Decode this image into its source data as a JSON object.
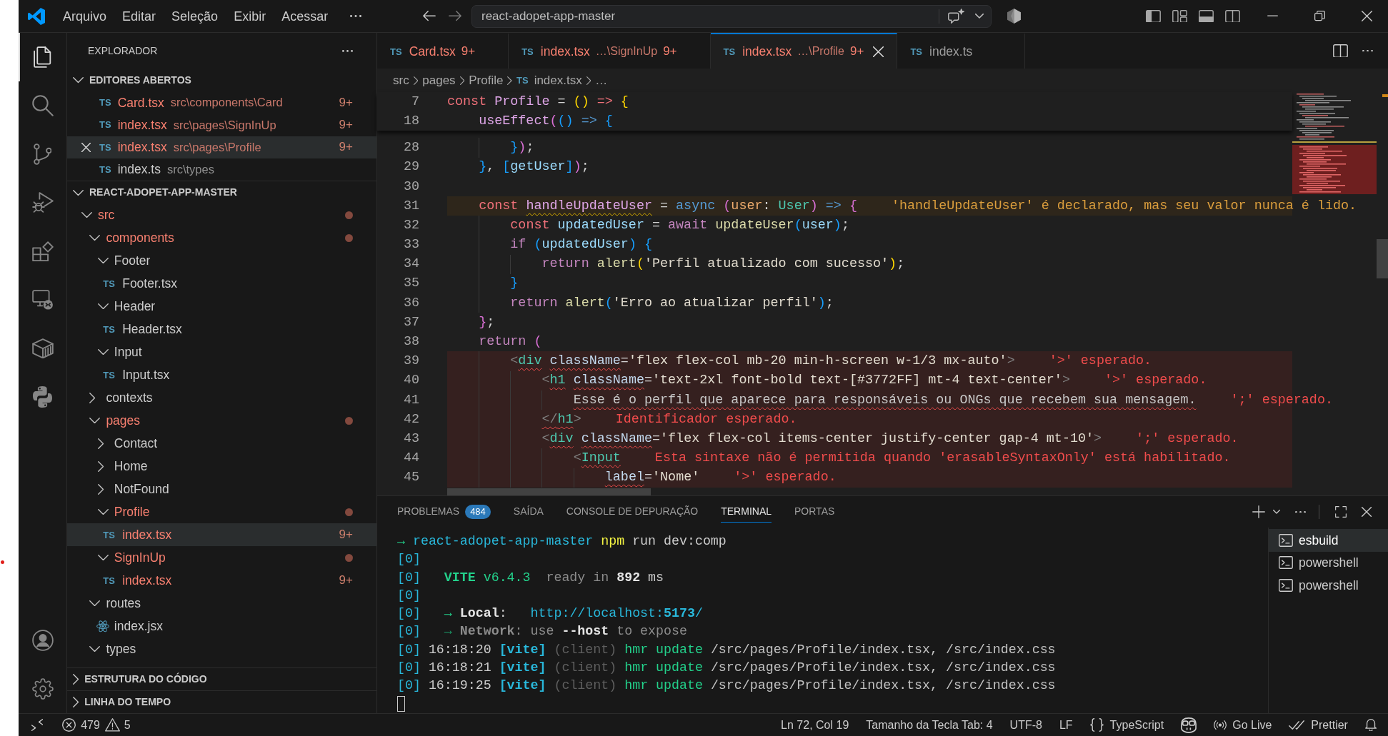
{
  "title_bar": {
    "menu": [
      {
        "label": "Arquivo"
      },
      {
        "label": "Editar"
      },
      {
        "label": "Seleção"
      },
      {
        "label": "Exibir"
      },
      {
        "label": "Acessar"
      }
    ],
    "command_center": {
      "label": "react-adopet-app-master"
    }
  },
  "activity_bar": {
    "items": [
      {
        "kind": "explorer",
        "selected": true
      },
      {
        "kind": "search",
        "selected": false
      },
      {
        "kind": "source-control",
        "selected": false
      },
      {
        "kind": "run-debug",
        "selected": false
      },
      {
        "kind": "extensions",
        "selected": false
      },
      {
        "kind": "remote",
        "selected": false
      },
      {
        "kind": "containers",
        "selected": false
      },
      {
        "kind": "python",
        "selected": false
      }
    ],
    "bottom_items": [
      {
        "kind": "account"
      },
      {
        "kind": "settings"
      }
    ]
  },
  "sidebar": {
    "title": "EXPLORADOR",
    "open_editors": {
      "title": "EDITORES ABERTOS",
      "expanded": true,
      "items": [
        {
          "type_label": "TS",
          "name": "Card.tsx",
          "path": "src\\components\\Card",
          "problems": true,
          "badge": "9+",
          "selected": false
        },
        {
          "type_label": "TS",
          "name": "index.tsx",
          "path": "src\\pages\\SignInUp",
          "problems": true,
          "badge": "9+",
          "selected": false
        },
        {
          "type_label": "TS",
          "name": "index.tsx",
          "path": "src\\pages\\Profile",
          "problems": true,
          "badge": "9+",
          "selected": true
        },
        {
          "type_label": "TS",
          "name": "index.ts",
          "path": "src\\types",
          "problems": false,
          "selected": false
        }
      ]
    },
    "project": {
      "title": "REACT-ADOPET-APP-MASTER",
      "expanded": true,
      "tree": [
        {
          "kind": "folder",
          "label": "src",
          "expanded": true,
          "problems": true,
          "selected": false,
          "children": [
            {
              "kind": "folder",
              "label": "components",
              "expanded": true,
              "problems": true,
              "selected": false,
              "children": [
                {
                  "kind": "folder",
                  "label": "Footer",
                  "expanded": true,
                  "problems": false,
                  "selected": false,
                  "children": [
                    {
                      "kind": "ts",
                      "type_label": "TS",
                      "label": "Footer.tsx",
                      "problems": false,
                      "selected": false
                    }
                  ]
                },
                {
                  "kind": "folder",
                  "label": "Header",
                  "expanded": true,
                  "problems": false,
                  "selected": false,
                  "children": [
                    {
                      "kind": "ts",
                      "type_label": "TS",
                      "label": "Header.tsx",
                      "problems": false,
                      "selected": false
                    }
                  ]
                },
                {
                  "kind": "folder",
                  "label": "Input",
                  "expanded": true,
                  "problems": false,
                  "selected": false,
                  "children": [
                    {
                      "kind": "ts",
                      "type_label": "TS",
                      "label": "Input.tsx",
                      "problems": false,
                      "selected": false
                    }
                  ]
                }
              ]
            },
            {
              "kind": "folder",
              "label": "contexts",
              "expanded": false,
              "problems": false,
              "selected": false
            },
            {
              "kind": "folder",
              "label": "pages",
              "expanded": true,
              "problems": true,
              "selected": false,
              "children": [
                {
                  "kind": "folder",
                  "label": "Contact",
                  "expanded": false,
                  "problems": false,
                  "selected": false
                },
                {
                  "kind": "folder",
                  "label": "Home",
                  "expanded": false,
                  "problems": false,
                  "selected": false
                },
                {
                  "kind": "folder",
                  "label": "NotFound",
                  "expanded": false,
                  "problems": false,
                  "selected": false
                },
                {
                  "kind": "folder",
                  "label": "Profile",
                  "expanded": true,
                  "problems": true,
                  "selected": false,
                  "children": [
                    {
                      "kind": "ts",
                      "type_label": "TS",
                      "label": "index.tsx",
                      "problems": true,
                      "badge": "9+",
                      "selected": true
                    }
                  ]
                },
                {
                  "kind": "folder",
                  "label": "SignInUp",
                  "expanded": true,
                  "problems": true,
                  "selected": false,
                  "children": [
                    {
                      "kind": "ts",
                      "type_label": "TS",
                      "label": "index.tsx",
                      "problems": true,
                      "badge": "9+",
                      "selected": false
                    }
                  ]
                }
              ]
            },
            {
              "kind": "folder",
              "label": "routes",
              "expanded": true,
              "problems": false,
              "selected": false,
              "children": [
                {
                  "kind": "react",
                  "label": "index.jsx",
                  "problems": false,
                  "selected": false
                }
              ]
            },
            {
              "kind": "folder",
              "label": "types",
              "expanded": true,
              "problems": false,
              "selected": false
            }
          ]
        }
      ]
    },
    "collapsed_sections": [
      {
        "title": "ESTRUTURA DO CÓDIGO",
        "expanded": false
      },
      {
        "title": "LINHA DO TEMPO",
        "expanded": false
      }
    ]
  },
  "editor": {
    "tabs": [
      {
        "type_label": "TS",
        "name": "Card.tsx",
        "badge": "9+",
        "problems": true,
        "selected": false
      },
      {
        "type_label": "TS",
        "name": "index.tsx",
        "description": "…\\SignInUp",
        "badge": "9+",
        "problems": true,
        "selected": false
      },
      {
        "type_label": "TS",
        "name": "index.tsx",
        "description": "…\\Profile",
        "badge": "9+",
        "problems": true,
        "selected": true
      },
      {
        "type_label": "TS",
        "name": "index.ts",
        "problems": false,
        "selected": false
      }
    ],
    "breadcrumb": [
      {
        "kind": "folder",
        "label": "src"
      },
      {
        "kind": "folder",
        "label": "pages"
      },
      {
        "kind": "folder",
        "label": "Profile"
      },
      {
        "kind": "file",
        "type_label": "TS",
        "label": "index.tsx"
      },
      {
        "kind": "symbol",
        "label": "…"
      }
    ],
    "sticky_lines": [
      {
        "number": "7",
        "tokens": [
          {
            "text": "const",
            "kind": "storage"
          },
          {
            "text": " Profile",
            "kind": "function-name"
          },
          {
            "text": " =",
            "kind": "plain"
          },
          {
            "text": " ()",
            "kind": "bracket1"
          },
          {
            "text": " =>",
            "kind": "storage"
          },
          {
            "text": " {",
            "kind": "bracket1"
          }
        ]
      },
      {
        "number": "18",
        "tokens": [
          {
            "text": "    useEffect",
            "kind": "function-name"
          },
          {
            "text": "(",
            "kind": "bracket2"
          },
          {
            "text": "()",
            "kind": "bracket3"
          },
          {
            "text": " =>",
            "kind": "modifier"
          },
          {
            "text": " {",
            "kind": "bracket3"
          }
        ]
      }
    ],
    "lines": [
      {
        "number": "28",
        "tokens": [
          {
            "text": "        }",
            "kind": "bracket3"
          },
          {
            "text": ")",
            "kind": "bracket2"
          },
          {
            "text": ";",
            "kind": "plain"
          }
        ]
      },
      {
        "number": "29",
        "tokens": [
          {
            "text": "    }",
            "kind": "bracket3"
          },
          {
            "text": ", ",
            "kind": "plain"
          },
          {
            "text": "[",
            "kind": "bracket3"
          },
          {
            "text": "getUser",
            "kind": "variable"
          },
          {
            "text": "]",
            "kind": "bracket3"
          },
          {
            "text": ")",
            "kind": "bracket2"
          },
          {
            "text": ";",
            "kind": "plain"
          }
        ]
      },
      {
        "number": "30"
      },
      {
        "number": "31",
        "tokens": [
          {
            "text": "    const ",
            "kind": "storage",
            "squiggly": false
          },
          {
            "text": "handleUpdateUser",
            "kind": "function-name",
            "squiggly": true
          },
          {
            "text": " =",
            "kind": "plain",
            "squiggly": false
          },
          {
            "text": " async",
            "kind": "modifier",
            "squiggly": false
          },
          {
            "text": " (",
            "kind": "bracket2",
            "squiggly": false
          },
          {
            "text": "user",
            "kind": "parameter",
            "squiggly": false
          },
          {
            "text": ":",
            "kind": "plain",
            "squiggly": false
          },
          {
            "text": " User",
            "kind": "type",
            "squiggly": false
          },
          {
            "text": ")",
            "kind": "bracket2",
            "squiggly": false
          },
          {
            "text": " =>",
            "kind": "modifier",
            "squiggly": false
          },
          {
            "text": " {",
            "kind": "bracket2",
            "squiggly": false
          }
        ],
        "diagnostic": {
          "kind": "warning",
          "message": "'handleUpdateUser' é declarado, mas seu valor nunca é lido."
        }
      },
      {
        "number": "32",
        "tokens": [
          {
            "text": "        const",
            "kind": "storage"
          },
          {
            "text": " updatedUser",
            "kind": "variable"
          },
          {
            "text": " =",
            "kind": "plain"
          },
          {
            "text": " await",
            "kind": "keyword"
          },
          {
            "text": " updateUser",
            "kind": "call"
          },
          {
            "text": "(",
            "kind": "bracket3"
          },
          {
            "text": "user",
            "kind": "variable"
          },
          {
            "text": ")",
            "kind": "bracket3"
          },
          {
            "text": ";",
            "kind": "plain"
          }
        ]
      },
      {
        "number": "33",
        "tokens": [
          {
            "text": "        if",
            "kind": "keyword"
          },
          {
            "text": " (",
            "kind": "bracket3"
          },
          {
            "text": "updatedUser",
            "kind": "variable"
          },
          {
            "text": ")",
            "kind": "bracket3"
          },
          {
            "text": " {",
            "kind": "bracket3"
          }
        ]
      },
      {
        "number": "34",
        "tokens": [
          {
            "text": "            return",
            "kind": "keyword"
          },
          {
            "text": " alert",
            "kind": "call"
          },
          {
            "text": "(",
            "kind": "bracket1"
          },
          {
            "text": "'Perfil atualizado com sucesso'",
            "kind": "string"
          },
          {
            "text": ")",
            "kind": "bracket1"
          },
          {
            "text": ";",
            "kind": "plain"
          }
        ]
      },
      {
        "number": "35",
        "tokens": [
          {
            "text": "        }",
            "kind": "bracket3"
          }
        ]
      },
      {
        "number": "36",
        "tokens": [
          {
            "text": "        return",
            "kind": "keyword"
          },
          {
            "text": " alert",
            "kind": "call"
          },
          {
            "text": "(",
            "kind": "bracket3"
          },
          {
            "text": "'Erro ao atualizar perfil'",
            "kind": "string"
          },
          {
            "text": ")",
            "kind": "bracket3"
          },
          {
            "text": ";",
            "kind": "plain"
          }
        ]
      },
      {
        "number": "37",
        "tokens": [
          {
            "text": "    }",
            "kind": "bracket2"
          },
          {
            "text": ";",
            "kind": "plain"
          }
        ]
      },
      {
        "number": "38",
        "tokens": [
          {
            "text": "    return",
            "kind": "keyword"
          },
          {
            "text": " (",
            "kind": "bracket2"
          }
        ]
      },
      {
        "number": "39",
        "tokens": [
          {
            "text": "        <",
            "kind": "tag-punct",
            "squiggly": false
          },
          {
            "text": "div",
            "kind": "tag",
            "squiggly": true
          },
          {
            "text": " className",
            "kind": "attribute",
            "squiggly": true
          },
          {
            "text": "=",
            "kind": "plain",
            "squiggly": false
          },
          {
            "text": "'flex flex-col mb-20 min-h-screen w-1/3 mx-auto'",
            "kind": "string",
            "squiggly": false
          },
          {
            "text": ">",
            "kind": "tag-punct",
            "squiggly": false
          }
        ],
        "diagnostic": {
          "kind": "error",
          "message": "'>' esperado."
        }
      },
      {
        "number": "40",
        "tokens": [
          {
            "text": "            <",
            "kind": "tag-punct",
            "squiggly": false
          },
          {
            "text": "h1",
            "kind": "tag",
            "squiggly": true
          },
          {
            "text": " className",
            "kind": "attribute",
            "squiggly": true
          },
          {
            "text": "=",
            "kind": "plain",
            "squiggly": false
          },
          {
            "text": "'text-2xl font-bold text-[#3772FF] mt-4 text-center'",
            "kind": "string",
            "squiggly": false
          },
          {
            "text": ">",
            "kind": "tag-punct",
            "squiggly": false
          }
        ],
        "diagnostic": {
          "kind": "error",
          "message": "'>' esperado."
        }
      },
      {
        "number": "41",
        "tokens": [
          {
            "text": "                Esse é o perfil que aparece para responsáveis ou ONGs que recebem sua mensagem.",
            "kind": "text",
            "squiggly": true
          }
        ],
        "diagnostic": {
          "kind": "error",
          "message": "';' esperado."
        }
      },
      {
        "number": "42",
        "tokens": [
          {
            "text": "            </",
            "kind": "tag-punct",
            "squiggly": true
          },
          {
            "text": "h1",
            "kind": "tag",
            "squiggly": true
          },
          {
            "text": ">",
            "kind": "tag-punct",
            "squiggly": false
          }
        ],
        "diagnostic": {
          "kind": "error",
          "message": "Identificador esperado."
        }
      },
      {
        "number": "43",
        "tokens": [
          {
            "text": "            <",
            "kind": "tag-punct",
            "squiggly": false
          },
          {
            "text": "div",
            "kind": "tag",
            "squiggly": true
          },
          {
            "text": " className",
            "kind": "attribute",
            "squiggly": true
          },
          {
            "text": "=",
            "kind": "plain",
            "squiggly": false
          },
          {
            "text": "'flex flex-col items-center justify-center gap-4 mt-10'",
            "kind": "string",
            "squiggly": false
          },
          {
            "text": ">",
            "kind": "tag-punct",
            "squiggly": false
          }
        ],
        "diagnostic": {
          "kind": "error",
          "message": "';' esperado."
        }
      },
      {
        "number": "44",
        "tokens": [
          {
            "text": "                <",
            "kind": "tag-punct",
            "squiggly": false
          },
          {
            "text": "Input",
            "kind": "tag",
            "squiggly": true
          }
        ],
        "diagnostic": {
          "kind": "error",
          "message": "Esta sintaxe não é permitida quando 'erasableSyntaxOnly' está habilitado."
        }
      },
      {
        "number": "45",
        "tokens": [
          {
            "text": "                    label",
            "kind": "attribute",
            "squiggly": true
          },
          {
            "text": "=",
            "kind": "plain",
            "squiggly": false
          },
          {
            "text": "'Nome'",
            "kind": "string",
            "squiggly": false
          }
        ],
        "diagnostic": {
          "kind": "error",
          "message": "'>' esperado."
        }
      }
    ]
  },
  "panel": {
    "tabs": [
      {
        "label": "PROBLEMAS",
        "badge": "484",
        "selected": false
      },
      {
        "label": "SAÍDA",
        "selected": false
      },
      {
        "label": "CONSOLE DE DEPURAÇÃO",
        "selected": false
      },
      {
        "label": "TERMINAL",
        "selected": true
      },
      {
        "label": "PORTAS",
        "selected": false
      }
    ],
    "terminal": {
      "lines": [
        {
          "segments": [
            {
              "text": "→",
              "kind": "arrow"
            },
            {
              "text": " react-adopet-app-master",
              "kind": "cwd"
            },
            {
              "text": " npm",
              "kind": "command"
            },
            {
              "text": " run dev:comp",
              "kind": "plain"
            }
          ]
        },
        {
          "segments": [
            {
              "text": "[0]",
              "kind": "prefix"
            }
          ]
        },
        {
          "segments": [
            {
              "text": "[0]",
              "kind": "prefix"
            },
            {
              "text": "   VITE",
              "kind": "brand"
            },
            {
              "text": " v6.4.3",
              "kind": "version"
            },
            {
              "text": "  ready in ",
              "kind": "muted"
            },
            {
              "text": "892",
              "kind": "strong"
            },
            {
              "text": " ms",
              "kind": "plain"
            }
          ]
        },
        {
          "segments": [
            {
              "text": "[0]",
              "kind": "prefix"
            }
          ]
        },
        {
          "segments": [
            {
              "text": "[0]",
              "kind": "prefix"
            },
            {
              "text": "   → ",
              "kind": "arrow"
            },
            {
              "text": "Local",
              "kind": "strong"
            },
            {
              "text": ":",
              "kind": "plain"
            },
            {
              "text": "   http://localhost:",
              "kind": "url"
            },
            {
              "text": "5173",
              "kind": "url-strong"
            },
            {
              "text": "/",
              "kind": "url"
            }
          ]
        },
        {
          "segments": [
            {
              "text": "[0]",
              "kind": "prefix"
            },
            {
              "text": "   → ",
              "kind": "arrow-dim"
            },
            {
              "text": "Network",
              "kind": "muted-strong"
            },
            {
              "text": ": use ",
              "kind": "muted"
            },
            {
              "text": "--host",
              "kind": "strong"
            },
            {
              "text": " to expose",
              "kind": "muted"
            }
          ]
        },
        {
          "segments": [
            {
              "text": "[0]",
              "kind": "prefix"
            },
            {
              "text": " 16:18:20",
              "kind": "time"
            },
            {
              "text": " [vite]",
              "kind": "source"
            },
            {
              "text": " (client)",
              "kind": "faint"
            },
            {
              "text": " hmr update",
              "kind": "event"
            },
            {
              "text": " /src/pages/Profile/index.tsx, /src/index.css",
              "kind": "file"
            }
          ]
        },
        {
          "segments": [
            {
              "text": "[0]",
              "kind": "prefix"
            },
            {
              "text": " 16:18:21",
              "kind": "time"
            },
            {
              "text": " [vite]",
              "kind": "source"
            },
            {
              "text": " (client)",
              "kind": "faint"
            },
            {
              "text": " hmr update",
              "kind": "event"
            },
            {
              "text": " /src/pages/Profile/index.tsx, /src/index.css",
              "kind": "file"
            }
          ]
        },
        {
          "segments": [
            {
              "text": "[0]",
              "kind": "prefix"
            },
            {
              "text": " 16:19:25",
              "kind": "time"
            },
            {
              "text": " [vite]",
              "kind": "source"
            },
            {
              "text": " (client)",
              "kind": "faint"
            },
            {
              "text": " hmr update",
              "kind": "event"
            },
            {
              "text": " /src/pages/Profile/index.tsx, /src/index.css",
              "kind": "file"
            }
          ]
        }
      ]
    },
    "terminal_list": [
      {
        "label": "esbuild",
        "selected": true
      },
      {
        "label": "powershell",
        "selected": false
      },
      {
        "label": "powershell",
        "selected": false
      }
    ]
  },
  "status_bar": {
    "errors": "479",
    "warnings": "5",
    "position": "Ln 72, Col 19",
    "indentation": "Tamanho da Tecla Tab: 4",
    "encoding": "UTF-8",
    "line_ending": "LF",
    "language": "TypeScript",
    "live_server": "Go Live",
    "formatter": "Prettier"
  }
}
